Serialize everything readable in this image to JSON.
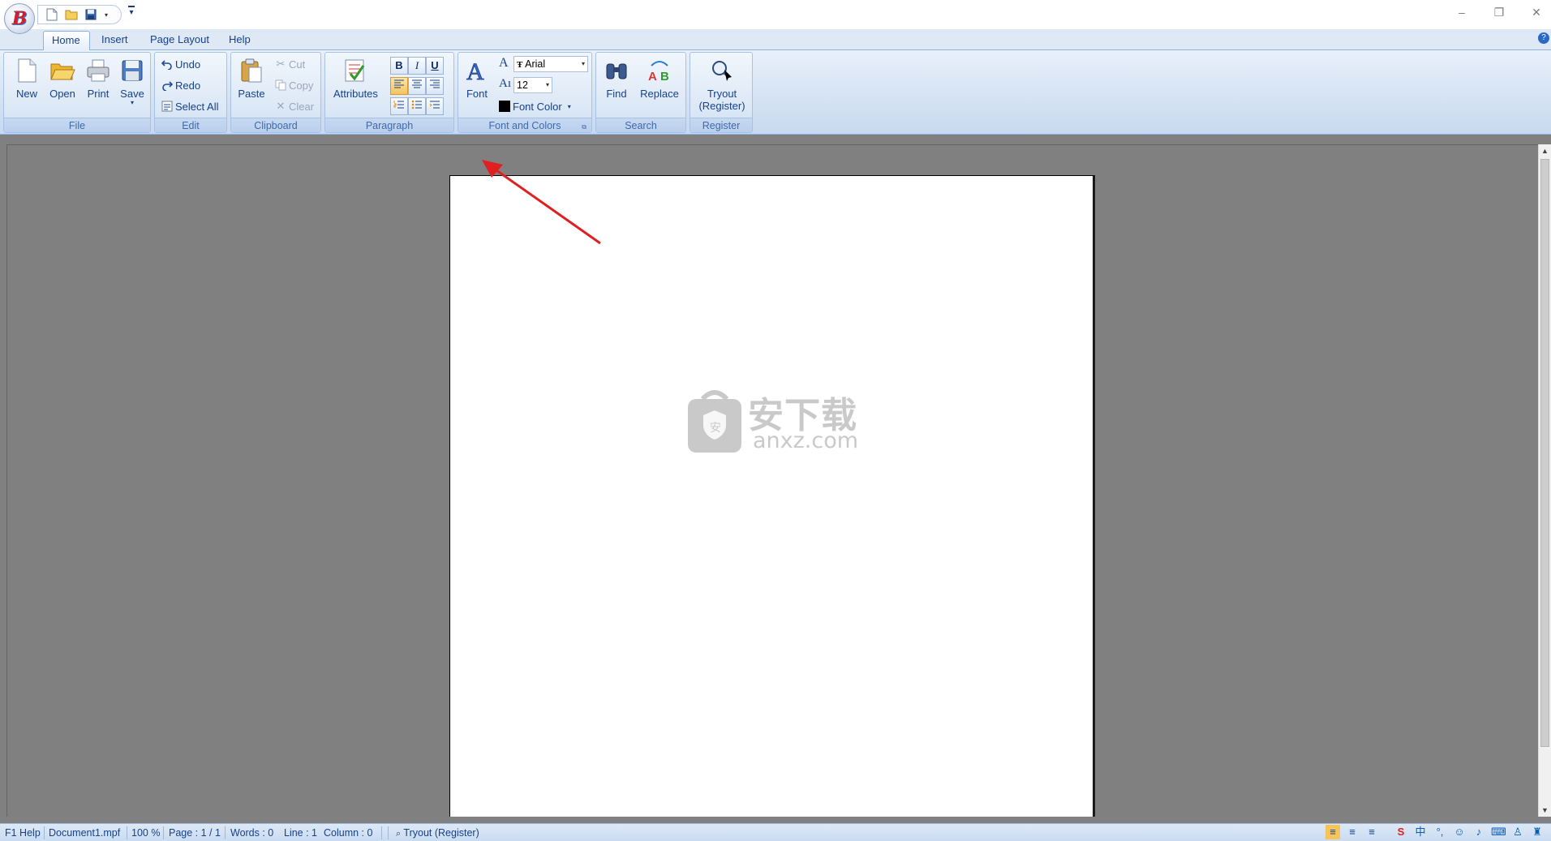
{
  "qat": {
    "icons": [
      "new-doc-icon",
      "open-folder-icon",
      "save-disk-icon",
      "dropdown-arrow-icon",
      "customize-qat-icon"
    ]
  },
  "window": {
    "minimize": "–",
    "restore": "❐",
    "close": "✕"
  },
  "tabs": [
    {
      "label": "Home",
      "active": true
    },
    {
      "label": "Insert"
    },
    {
      "label": "Page Layout"
    },
    {
      "label": "Help"
    }
  ],
  "groups": {
    "file": {
      "label": "File",
      "new": "New",
      "open": "Open",
      "print": "Print",
      "save": "Save"
    },
    "edit": {
      "label": "Edit",
      "undo": "Undo",
      "redo": "Redo",
      "select_all": "Select All"
    },
    "clipboard": {
      "label": "Clipboard",
      "paste": "Paste",
      "cut": "Cut",
      "copy": "Copy",
      "clear": "Clear"
    },
    "paragraph": {
      "label": "Paragraph",
      "attributes": "Attributes",
      "bold": "B",
      "italic": "I",
      "underline": "U"
    },
    "font_colors": {
      "label": "Font and Colors",
      "font": "Font",
      "font_name": "Arial",
      "font_size": "12",
      "font_color": "Font Color",
      "color_swatch": "#000000"
    },
    "search": {
      "label": "Search",
      "find": "Find",
      "replace": "Replace"
    },
    "register": {
      "label": "Register",
      "tryout": "Tryout\n(Register)",
      "tryout_line1": "Tryout",
      "tryout_line2": "(Register)"
    }
  },
  "watermark": {
    "cn": "安下载",
    "url": "anxz.com"
  },
  "status": {
    "help": "F1 Help",
    "file": "Document1.mpf",
    "zoom": "100 %",
    "page": "Page : 1 / 1",
    "words": "Words : 0",
    "line": "Line : 1",
    "column": "Column : 0",
    "register": "Tryout (Register)"
  },
  "colors": {
    "accent": "#15428b",
    "ribbon_bg": "#dce8f6",
    "annotation_arrow": "#e02020",
    "doc_background": "#808080"
  }
}
